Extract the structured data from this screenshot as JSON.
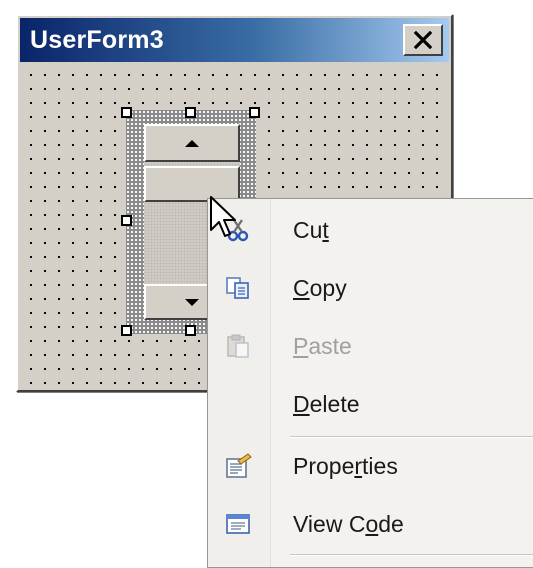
{
  "window": {
    "title": "UserForm3",
    "close_glyph": "✕"
  },
  "control": {
    "type": "SpinButton",
    "selected": true
  },
  "context_menu": {
    "items": [
      {
        "id": "cut",
        "pre": "Cu",
        "accel": "t",
        "post": "",
        "icon": "scissors-icon",
        "enabled": true
      },
      {
        "id": "copy",
        "pre": "",
        "accel": "C",
        "post": "opy",
        "icon": "copy-icon",
        "enabled": true
      },
      {
        "id": "paste",
        "pre": "",
        "accel": "P",
        "post": "aste",
        "icon": "paste-icon",
        "enabled": false
      },
      {
        "id": "delete",
        "pre": "",
        "accel": "D",
        "post": "elete",
        "icon": "",
        "enabled": true
      },
      {
        "id": "properties",
        "pre": "Prope",
        "accel": "r",
        "post": "ties",
        "icon": "properties-icon",
        "enabled": true
      },
      {
        "id": "view-code",
        "pre": "View C",
        "accel": "o",
        "post": "de",
        "icon": "view-code-icon",
        "enabled": true
      }
    ]
  },
  "colors": {
    "title_start": "#0a246a",
    "title_end": "#a6caf0",
    "face": "#d4d0c8",
    "menu_bg": "#f4f2ef",
    "disabled_text": "#a0a0a0"
  }
}
